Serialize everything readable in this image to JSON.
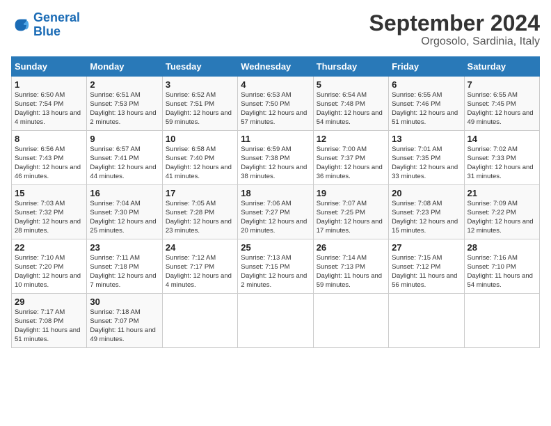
{
  "logo": {
    "line1": "General",
    "line2": "Blue"
  },
  "title": "September 2024",
  "location": "Orgosolo, Sardinia, Italy",
  "headers": [
    "Sunday",
    "Monday",
    "Tuesday",
    "Wednesday",
    "Thursday",
    "Friday",
    "Saturday"
  ],
  "weeks": [
    [
      {
        "day": "1",
        "sunrise": "Sunrise: 6:50 AM",
        "sunset": "Sunset: 7:54 PM",
        "daylight": "Daylight: 13 hours and 4 minutes."
      },
      {
        "day": "2",
        "sunrise": "Sunrise: 6:51 AM",
        "sunset": "Sunset: 7:53 PM",
        "daylight": "Daylight: 13 hours and 2 minutes."
      },
      {
        "day": "3",
        "sunrise": "Sunrise: 6:52 AM",
        "sunset": "Sunset: 7:51 PM",
        "daylight": "Daylight: 12 hours and 59 minutes."
      },
      {
        "day": "4",
        "sunrise": "Sunrise: 6:53 AM",
        "sunset": "Sunset: 7:50 PM",
        "daylight": "Daylight: 12 hours and 57 minutes."
      },
      {
        "day": "5",
        "sunrise": "Sunrise: 6:54 AM",
        "sunset": "Sunset: 7:48 PM",
        "daylight": "Daylight: 12 hours and 54 minutes."
      },
      {
        "day": "6",
        "sunrise": "Sunrise: 6:55 AM",
        "sunset": "Sunset: 7:46 PM",
        "daylight": "Daylight: 12 hours and 51 minutes."
      },
      {
        "day": "7",
        "sunrise": "Sunrise: 6:55 AM",
        "sunset": "Sunset: 7:45 PM",
        "daylight": "Daylight: 12 hours and 49 minutes."
      }
    ],
    [
      {
        "day": "8",
        "sunrise": "Sunrise: 6:56 AM",
        "sunset": "Sunset: 7:43 PM",
        "daylight": "Daylight: 12 hours and 46 minutes."
      },
      {
        "day": "9",
        "sunrise": "Sunrise: 6:57 AM",
        "sunset": "Sunset: 7:41 PM",
        "daylight": "Daylight: 12 hours and 44 minutes."
      },
      {
        "day": "10",
        "sunrise": "Sunrise: 6:58 AM",
        "sunset": "Sunset: 7:40 PM",
        "daylight": "Daylight: 12 hours and 41 minutes."
      },
      {
        "day": "11",
        "sunrise": "Sunrise: 6:59 AM",
        "sunset": "Sunset: 7:38 PM",
        "daylight": "Daylight: 12 hours and 38 minutes."
      },
      {
        "day": "12",
        "sunrise": "Sunrise: 7:00 AM",
        "sunset": "Sunset: 7:37 PM",
        "daylight": "Daylight: 12 hours and 36 minutes."
      },
      {
        "day": "13",
        "sunrise": "Sunrise: 7:01 AM",
        "sunset": "Sunset: 7:35 PM",
        "daylight": "Daylight: 12 hours and 33 minutes."
      },
      {
        "day": "14",
        "sunrise": "Sunrise: 7:02 AM",
        "sunset": "Sunset: 7:33 PM",
        "daylight": "Daylight: 12 hours and 31 minutes."
      }
    ],
    [
      {
        "day": "15",
        "sunrise": "Sunrise: 7:03 AM",
        "sunset": "Sunset: 7:32 PM",
        "daylight": "Daylight: 12 hours and 28 minutes."
      },
      {
        "day": "16",
        "sunrise": "Sunrise: 7:04 AM",
        "sunset": "Sunset: 7:30 PM",
        "daylight": "Daylight: 12 hours and 25 minutes."
      },
      {
        "day": "17",
        "sunrise": "Sunrise: 7:05 AM",
        "sunset": "Sunset: 7:28 PM",
        "daylight": "Daylight: 12 hours and 23 minutes."
      },
      {
        "day": "18",
        "sunrise": "Sunrise: 7:06 AM",
        "sunset": "Sunset: 7:27 PM",
        "daylight": "Daylight: 12 hours and 20 minutes."
      },
      {
        "day": "19",
        "sunrise": "Sunrise: 7:07 AM",
        "sunset": "Sunset: 7:25 PM",
        "daylight": "Daylight: 12 hours and 17 minutes."
      },
      {
        "day": "20",
        "sunrise": "Sunrise: 7:08 AM",
        "sunset": "Sunset: 7:23 PM",
        "daylight": "Daylight: 12 hours and 15 minutes."
      },
      {
        "day": "21",
        "sunrise": "Sunrise: 7:09 AM",
        "sunset": "Sunset: 7:22 PM",
        "daylight": "Daylight: 12 hours and 12 minutes."
      }
    ],
    [
      {
        "day": "22",
        "sunrise": "Sunrise: 7:10 AM",
        "sunset": "Sunset: 7:20 PM",
        "daylight": "Daylight: 12 hours and 10 minutes."
      },
      {
        "day": "23",
        "sunrise": "Sunrise: 7:11 AM",
        "sunset": "Sunset: 7:18 PM",
        "daylight": "Daylight: 12 hours and 7 minutes."
      },
      {
        "day": "24",
        "sunrise": "Sunrise: 7:12 AM",
        "sunset": "Sunset: 7:17 PM",
        "daylight": "Daylight: 12 hours and 4 minutes."
      },
      {
        "day": "25",
        "sunrise": "Sunrise: 7:13 AM",
        "sunset": "Sunset: 7:15 PM",
        "daylight": "Daylight: 12 hours and 2 minutes."
      },
      {
        "day": "26",
        "sunrise": "Sunrise: 7:14 AM",
        "sunset": "Sunset: 7:13 PM",
        "daylight": "Daylight: 11 hours and 59 minutes."
      },
      {
        "day": "27",
        "sunrise": "Sunrise: 7:15 AM",
        "sunset": "Sunset: 7:12 PM",
        "daylight": "Daylight: 11 hours and 56 minutes."
      },
      {
        "day": "28",
        "sunrise": "Sunrise: 7:16 AM",
        "sunset": "Sunset: 7:10 PM",
        "daylight": "Daylight: 11 hours and 54 minutes."
      }
    ],
    [
      {
        "day": "29",
        "sunrise": "Sunrise: 7:17 AM",
        "sunset": "Sunset: 7:08 PM",
        "daylight": "Daylight: 11 hours and 51 minutes."
      },
      {
        "day": "30",
        "sunrise": "Sunrise: 7:18 AM",
        "sunset": "Sunset: 7:07 PM",
        "daylight": "Daylight: 11 hours and 49 minutes."
      },
      null,
      null,
      null,
      null,
      null
    ]
  ]
}
